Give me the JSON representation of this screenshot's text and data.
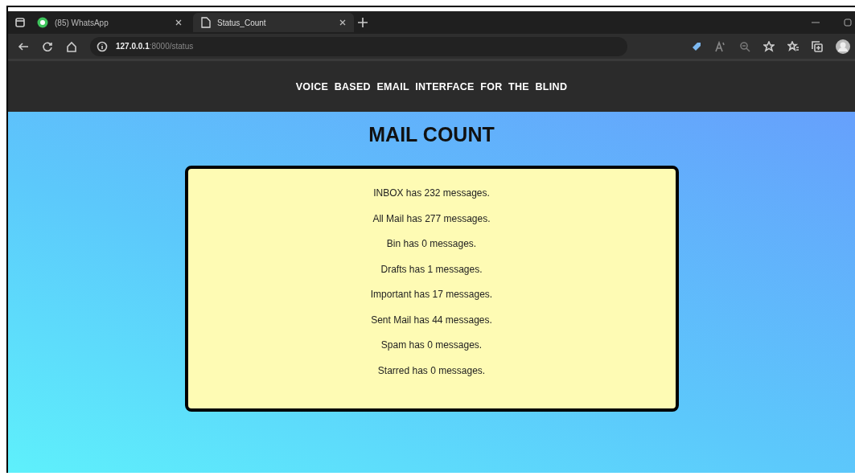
{
  "browser": {
    "tabs": [
      {
        "kind": "whatsapp",
        "label": "(85) WhatsApp",
        "selected": false
      },
      {
        "kind": "page",
        "label": "Status_Count",
        "selected": true
      }
    ],
    "address": {
      "host": "127.0.0.1",
      "rest": ":8000/status"
    }
  },
  "header": {
    "title": "VOICE  BASED  EMAIL  INTERFACE  FOR  THE  BLIND"
  },
  "heading": "MAIL COUNT",
  "counts": [
    "INBOX has 232 messages.",
    "All Mail has 277 messages.",
    "Bin has 0 messages.",
    "Drafts has 1 messages.",
    "Important has 17 messages.",
    "Sent Mail has 44 messages.",
    "Spam has 0 messages.",
    "Starred has 0 messages."
  ]
}
